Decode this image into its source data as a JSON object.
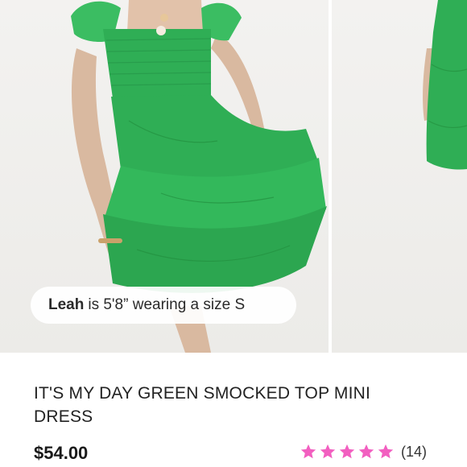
{
  "gallery": {
    "caption": {
      "model_name": "Leah",
      "description": "is 5'8” wearing a size S"
    }
  },
  "product": {
    "title": "IT'S MY DAY GREEN SMOCKED TOP MINI DRESS",
    "price": "$54.00",
    "rating": {
      "stars": 5,
      "count_label": "(14)",
      "star_color": "#f25fc0"
    }
  },
  "colors": {
    "dress_green": "#2fae55",
    "background": "#ffffff"
  }
}
